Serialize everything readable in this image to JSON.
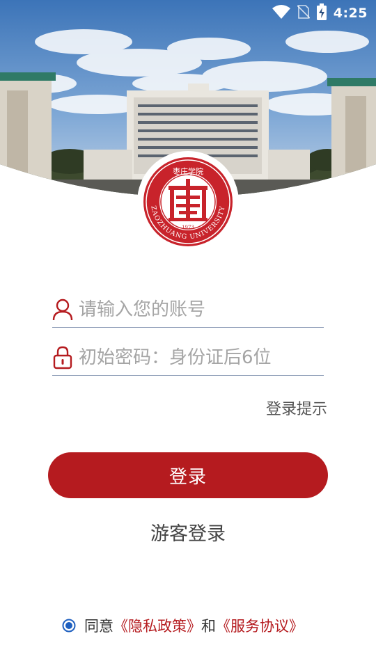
{
  "status_bar": {
    "time": "4:25",
    "icons": [
      "wifi-icon",
      "no-sim-icon",
      "battery-charging-icon"
    ]
  },
  "logo": {
    "name": "university-logo",
    "top_text": "枣庄学院",
    "ring_text": "ZAOZHUANG UNIVERSITY",
    "year": "1973"
  },
  "login_form": {
    "account_placeholder": "请输入您的账号",
    "password_placeholder": "初始密码：身份证后6位",
    "login_tip": "登录提示",
    "login_button": "登录",
    "guest_login": "游客登录"
  },
  "agreement": {
    "prefix": "同意",
    "privacy_policy": "《隐私政策》",
    "and": "和",
    "service_agreement": "《服务协议》"
  },
  "colors": {
    "brand_red": "#b51b1f",
    "radio_blue": "#1e5fbf",
    "underline": "#8a9ab5"
  }
}
